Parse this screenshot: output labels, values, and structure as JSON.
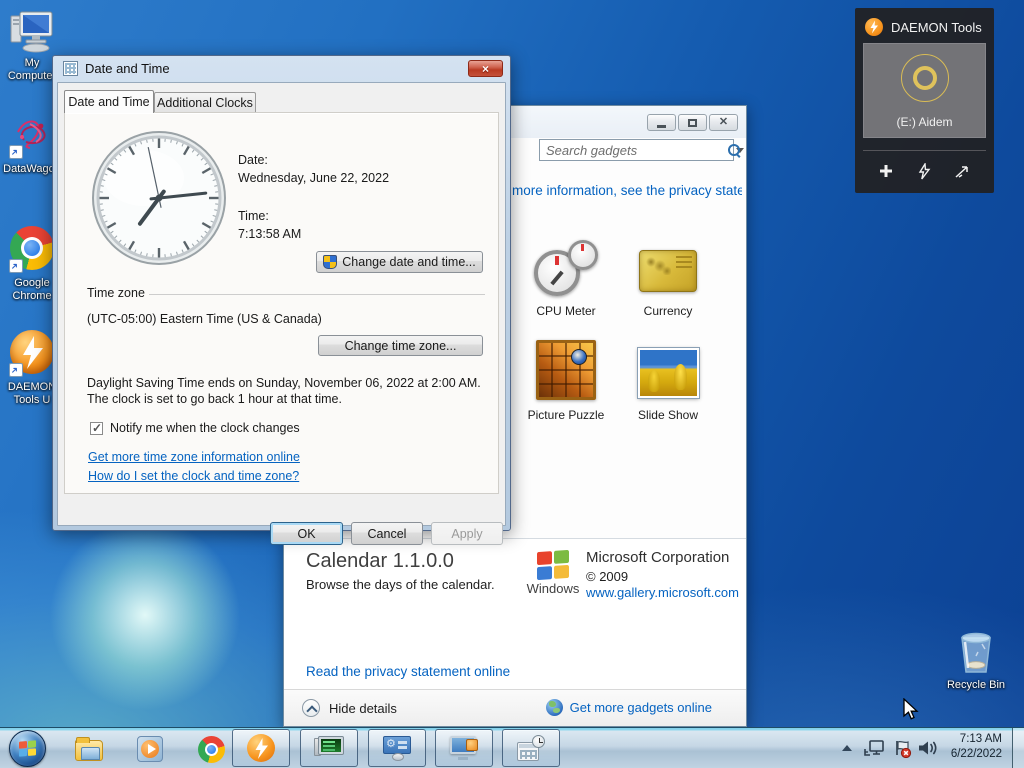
{
  "desktop": {
    "icons": [
      {
        "label": "My Computer"
      },
      {
        "label": "DataWagon"
      },
      {
        "label": "Google Chrome"
      },
      {
        "label": "DAEMON Tools U"
      }
    ],
    "recycle_bin_label": "Recycle Bin"
  },
  "daemon_gadget": {
    "title": "DAEMON Tools",
    "drive": "(E:) Aidem"
  },
  "gadget_window": {
    "search_placeholder": "Search gadgets",
    "privacy_notice": "For more information, see the privacy statement online",
    "gadgets": [
      {
        "name": "CPU Meter"
      },
      {
        "name": "Currency"
      },
      {
        "name": "Picture Puzzle"
      },
      {
        "name": "Slide Show"
      }
    ],
    "details": {
      "title": "Calendar 1.1.0.0",
      "description": "Browse the days of the calendar.",
      "brand": "Windows",
      "publisher": "Microsoft Corporation",
      "copyright": "© 2009",
      "url": "www.gallery.microsoft.com",
      "privacy_link": "Read the privacy statement online"
    },
    "footer": {
      "hide_details": "Hide details",
      "get_more": "Get more gadgets online"
    }
  },
  "dialog": {
    "title": "Date and Time",
    "tabs": [
      {
        "label": "Date and Time"
      },
      {
        "label": "Additional Clocks"
      }
    ],
    "date_label": "Date:",
    "date_value": "Wednesday, June 22, 2022",
    "time_label": "Time:",
    "time_value": "7:13:58 AM",
    "change_datetime": "Change date and time...",
    "timezone_group": "Time zone",
    "timezone_value": "(UTC-05:00) Eastern Time (US & Canada)",
    "change_timezone": "Change time zone...",
    "dst_notice": "Daylight Saving Time ends on Sunday, November 06, 2022 at 2:00 AM. The clock is set to go back 1 hour at that time.",
    "notify_label": "Notify me when the clock changes",
    "link_more_tz": "Get more time zone information online",
    "link_how": "How do I set the clock and time zone?",
    "ok": "OK",
    "cancel": "Cancel",
    "apply": "Apply",
    "close_glyph": "×"
  },
  "taskbar": {
    "tray_time": "7:13 AM",
    "tray_date": "6/22/2022"
  },
  "colors": {
    "link": "#0563c1",
    "daemon_orange": "#f7941d",
    "desktop_blue": "#155cb0",
    "gold": "#d4af37"
  }
}
